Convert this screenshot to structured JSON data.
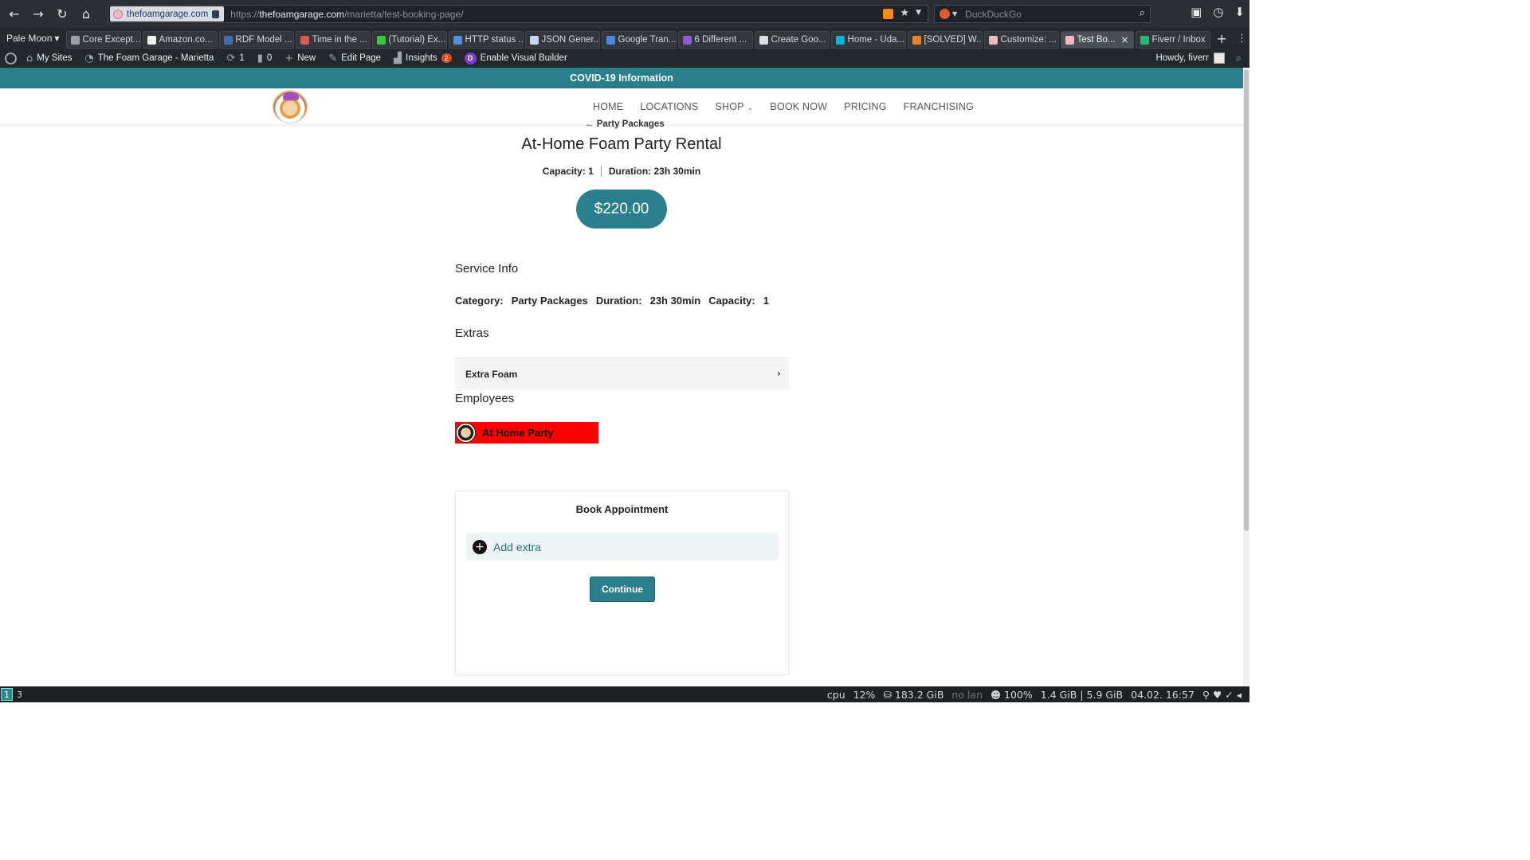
{
  "browser": {
    "identity_host": "thefoamgarage.com",
    "url_prefix": "https://",
    "url_host": "thefoamgarage.com",
    "url_path": "/marietta/test-booking-page/",
    "search_placeholder": "DuckDuckGo",
    "app_menu": "Pale Moon",
    "tabs": [
      {
        "label": "Core Except...",
        "color": "#9aa0a6"
      },
      {
        "label": "Amazon.co...",
        "color": "#f2f2f2"
      },
      {
        "label": "RDF Model ...",
        "color": "#3d6fb6"
      },
      {
        "label": "Time in the ...",
        "color": "#e0574f"
      },
      {
        "label": "(Tutorial) Ex...",
        "color": "#2ecc40"
      },
      {
        "label": "HTTP status ...",
        "color": "#4f8fe0"
      },
      {
        "label": "JSON Gener...",
        "color": "#c8d4f0"
      },
      {
        "label": "Google Tran...",
        "color": "#4a86e8"
      },
      {
        "label": "6 Different ...",
        "color": "#8e5ad6"
      },
      {
        "label": "Create Goo...",
        "color": "#dcdcdc"
      },
      {
        "label": "Home - Uda...",
        "color": "#02b3e4"
      },
      {
        "label": "[SOLVED] W...",
        "color": "#f48024"
      },
      {
        "label": "Customize: ...",
        "color": "#f2b8c6"
      },
      {
        "label": "Test Bo...",
        "color": "#f2b8c6",
        "active": true
      },
      {
        "label": "Fiverr / Inbox",
        "color": "#1dbf73"
      }
    ]
  },
  "wp_admin": {
    "my_sites": "My Sites",
    "site_name": "The Foam Garage - Marietta",
    "updates_count": "1",
    "comments_count": "0",
    "new_label": "New",
    "edit_page": "Edit Page",
    "insights": "Insights",
    "insights_badge": "2",
    "divi_letter": "D",
    "visual_builder": "Enable Visual Builder",
    "howdy": "Howdy, fiverr"
  },
  "site": {
    "covid": "COVID-19 Information",
    "nav": [
      "HOME",
      "LOCATIONS",
      "SHOP",
      "BOOK NOW",
      "PRICING",
      "FRANCHISING"
    ]
  },
  "service": {
    "back_link": "← Party Packages",
    "title": "At-Home Foam Party Rental",
    "capacity_meta": "Capacity: 1",
    "duration_meta": "Duration: 23h 30min",
    "price": "$220.00",
    "service_info_heading": "Service Info",
    "category_label": "Category:",
    "category_value": "Party Packages",
    "duration_label": "Duration:",
    "duration_value": "23h 30min",
    "capacity_label": "Capacity:",
    "capacity_value": "1",
    "extras_heading": "Extras",
    "extra_item": "Extra Foam",
    "employees_heading": "Employees",
    "employee_name": "At Home Party"
  },
  "booking": {
    "title": "Book Appointment",
    "add_extra": "Add extra",
    "continue": "Continue"
  },
  "statusbar": {
    "ws1": "1",
    "ws2": "3",
    "cpu_label": "cpu",
    "cpu_value": "12%",
    "disk": "183.2 GiB",
    "lan": "no lan",
    "battery": "100%",
    "mem": "1.4 GiB | 5.9 GiB",
    "datetime": "04.02. 16:57"
  },
  "colors": {
    "accent": "#2a7f8c",
    "employee_bg": "#ff0000"
  }
}
